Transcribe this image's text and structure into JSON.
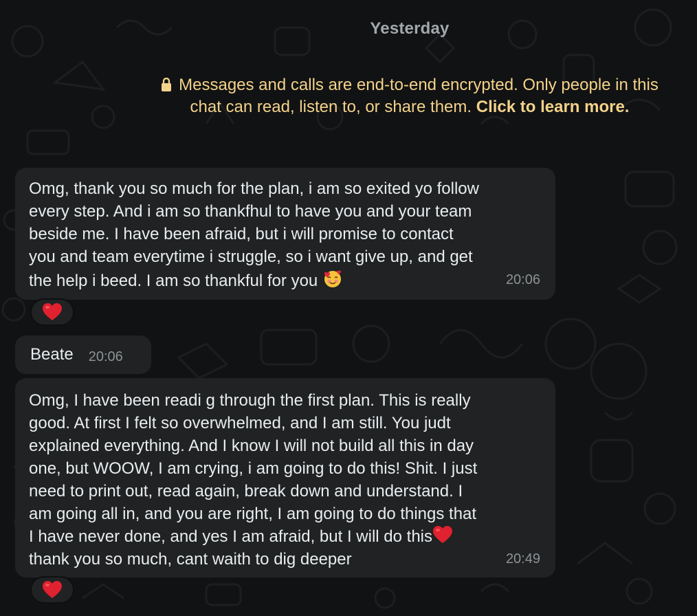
{
  "chat": {
    "date_label": "Yesterday",
    "encryption_notice": {
      "text": "Messages and calls are end-to-end encrypted. Only people in this chat can read, listen to, or share them.",
      "link": "Click to learn more."
    },
    "messages": [
      {
        "text": "Omg, thank you so much for the plan, i am so exited yo follow\nevery step. And i am so thankfhul to have you and your team\nbeside me. I have been afraid, but i will promise to contact\nyou and team everytime i struggle, so i want give up, and get\nthe help i beed. I am so thankful for you",
        "emoji": "smiling-face-with-hearts",
        "time": "20:06",
        "reaction": "red-heart"
      },
      {
        "sender": "Beate",
        "time": "20:06"
      },
      {
        "text_before_emoji": "Omg, I have been readi g through the first plan. This is really\ngood. At first I felt so overwhelmed, and I am still. You judt\nexplained everything. And I know I will not build all this in day\none, but WOOW, I am crying, i am going to do this! Shit. I just\nneed to print out, read again, break down and understand. I\nam going all in, and you are right, I am going to do things that\nI have never done, and yes I am afraid, but I will do this",
        "emoji": "red-heart",
        "text_after_emoji": "\nthank you so much, cant waith to dig deeper",
        "time": "20:49",
        "reaction": "red-heart"
      }
    ]
  },
  "colors": {
    "background": "#111213",
    "bubble": "#202223",
    "text": "#e9edef",
    "timestamp": "#8e9396",
    "date_label": "#a3a7ab",
    "encryption_notice": "#f3d28a",
    "heart": "#e02130"
  }
}
